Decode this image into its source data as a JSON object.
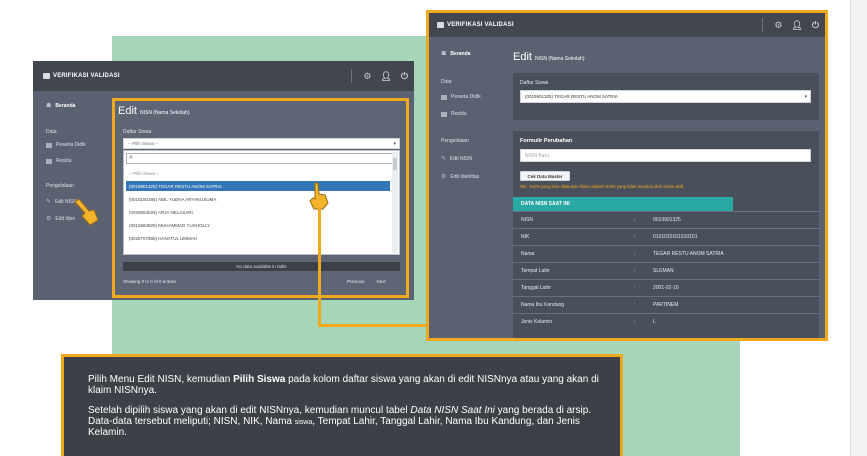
{
  "app": {
    "brand": "VERIFIKASI VALIDASI"
  },
  "sidebar": {
    "home": "Beranda",
    "section_data": "Data",
    "peserta_didik": "Peserta Didik",
    "residu": "Residu",
    "section_pengelolaan": "Pengelolaan",
    "edit_nisn": "Edit NISN",
    "edit_identitas": "Edit Identitas",
    "edit_identitas_short": "Edit Iden"
  },
  "left_screen": {
    "title": "Edit",
    "subtitle": "NISN (Nama Sekolah)",
    "daftar_siswa_label": "Daftar Siswa",
    "select_placeholder": "-- Pilih Siswa --",
    "dropdown_items": [
      "-- Pilih Siswa --",
      "(0019901325) TEGAR RESTU ANOM SATRIA",
      "(0015150286) ABIL YUDHA ARYAKUSUMA",
      "(0020654029) ARJA NELASARI",
      "(0010684828) MUHAMMAD YUSHOLLY",
      "(0025707685) HANATUL UMMAH"
    ],
    "no_data": "No data available in table",
    "showing": "Showing 0 to 0 of 0 entries",
    "previous": "Previous",
    "next": "Next"
  },
  "right_screen": {
    "title": "Edit",
    "subtitle": "NISN (Nama Sekolah)",
    "daftar_siswa_label": "Daftar Siswa",
    "selected_student": "(0019901325) TEGAR RESTU ANOM SATRIA",
    "form_title": "Formulir Perubahan",
    "nisn_baru_placeholder": "NISN Baru",
    "cek_button": "Cek Data Master",
    "note": "NB : NISN yang bisa dilakukan klaim adalah NISN yang tidak terpakai oleh siswa aktif.",
    "table_title": "DATA NISN SAAT INI",
    "rows": [
      {
        "key": "NISN",
        "sep": ":",
        "value": "0019901325"
      },
      {
        "key": "NIK",
        "sep": ":",
        "value": "0101010101010101"
      },
      {
        "key": "Nama",
        "sep": ":",
        "value": "TEGAR RESTU ANOM SATRIA"
      },
      {
        "key": "Tempat Lahir",
        "sep": ":",
        "value": "SLEMAN"
      },
      {
        "key": "Tanggal Lahir",
        "sep": ":",
        "value": "2001-02-10"
      },
      {
        "key": "Nama Ibu Kandung",
        "sep": ":",
        "value": "PARTINEM"
      },
      {
        "key": "Jenis Kelamin",
        "sep": ":",
        "value": "L"
      }
    ]
  },
  "caption": {
    "p1_a": "Pilih Menu Edit NISN, kemudian ",
    "p1_b": "Pilih Siswa",
    "p1_c": " pada kolom daftar siswa yang akan di edit NISNnya atau yang akan di klaim NISNnya.",
    "p2_a": "Setelah dipilih siswa yang akan di edit NISNnya, kemudian muncul  tabel ",
    "p2_b": "Data NISN Saat Ini",
    "p2_c": " yang berada di arsip. Data-data tersebut meliputi; NISN, NIK, Nama ",
    "p2_d": "siswa",
    "p2_e": ", Tempat Lahir, Tanggal Lahir, Nama Ibu Kandung, dan Jenis Kelamin."
  },
  "colors": {
    "accent": "#f0a81c",
    "green_panel": "#a6d5b8",
    "app_bg": "#5a6170",
    "highlight": "#3377b7",
    "table_head": "#2aa8a4",
    "caption_bg": "#3d4047"
  },
  "icons": [
    "gear-icon",
    "user-icon",
    "power-icon",
    "home-icon",
    "list-icon",
    "edit-icon",
    "search-icon",
    "pointer-hand-icon"
  ]
}
